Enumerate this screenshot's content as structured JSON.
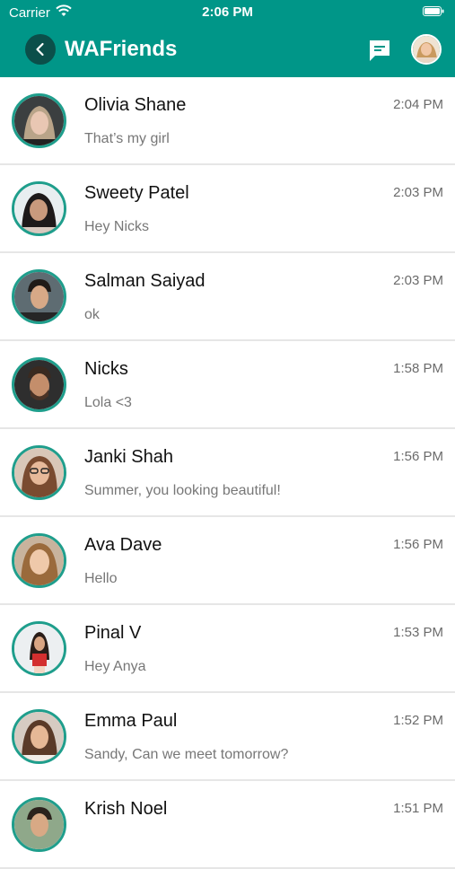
{
  "status_bar": {
    "carrier": "Carrier",
    "time": "2:06 PM"
  },
  "header": {
    "title": "WAFriends"
  },
  "colors": {
    "primary": "#009688",
    "avatar_ring": "#1f9e8c"
  },
  "conversations": [
    {
      "name": "Olivia Shane",
      "preview": "That’s my girl",
      "time": "2:04 PM"
    },
    {
      "name": "Sweety Patel",
      "preview": "Hey Nicks",
      "time": "2:03 PM"
    },
    {
      "name": "Salman Saiyad",
      "preview": "ok",
      "time": "2:03 PM"
    },
    {
      "name": "Nicks",
      "preview": "Lola <3",
      "time": "1:58 PM"
    },
    {
      "name": "Janki Shah",
      "preview": "Summer, you looking beautiful!",
      "time": "1:56 PM"
    },
    {
      "name": "Ava Dave",
      "preview": "Hello",
      "time": "1:56 PM"
    },
    {
      "name": "Pinal V",
      "preview": "Hey Anya",
      "time": "1:53 PM"
    },
    {
      "name": "Emma Paul",
      "preview": "Sandy, Can we meet tomorrow?",
      "time": "1:52 PM"
    },
    {
      "name": "Krish Noel",
      "preview": "",
      "time": "1:51 PM"
    }
  ]
}
